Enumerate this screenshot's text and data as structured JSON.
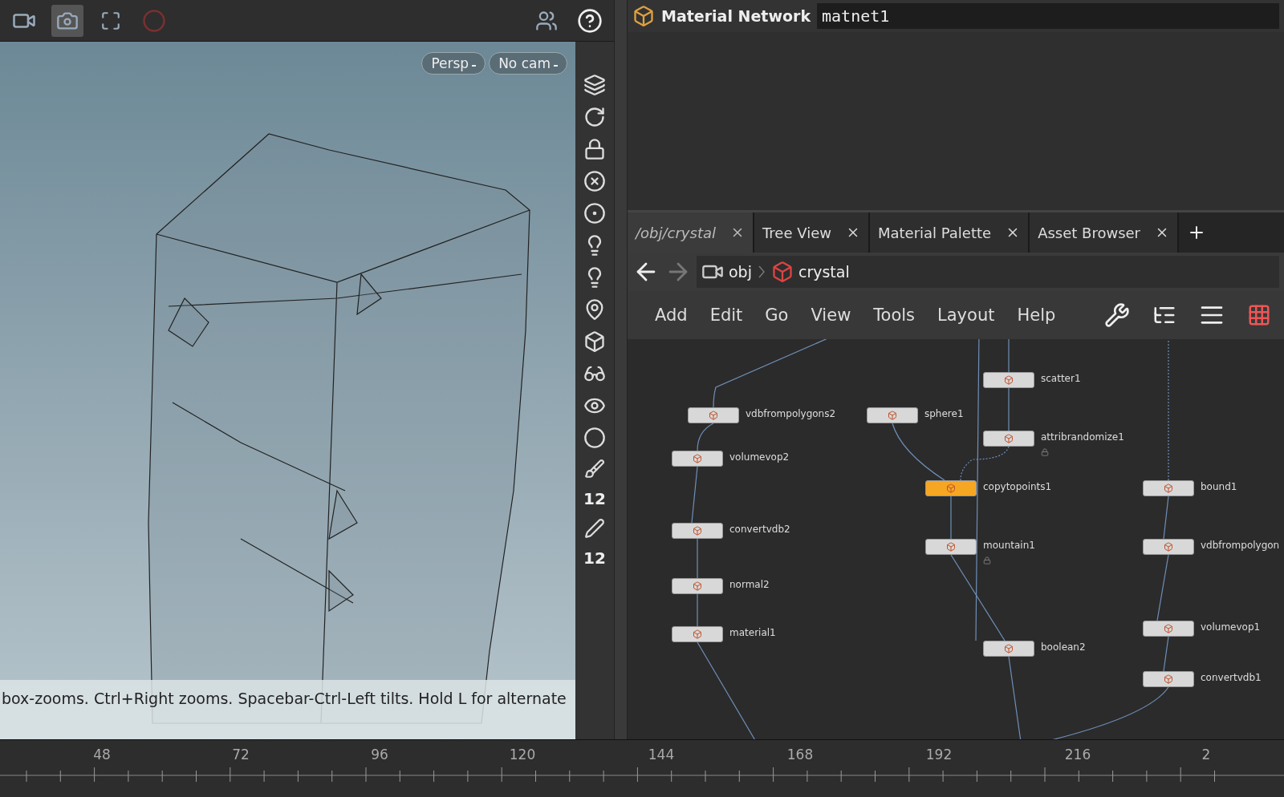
{
  "viewport": {
    "camera_menus": [
      "Persp",
      "No cam"
    ],
    "status": "box-zooms. Ctrl+Right zooms. Spacebar-Ctrl-Left tilts. Hold L for alternate"
  },
  "shelf_labels": [
    "12",
    "12"
  ],
  "material_network": {
    "title": "Material Network",
    "name_value": "matnet1"
  },
  "tabs": [
    {
      "label": "/obj/crystal",
      "selected": true
    },
    {
      "label": "Tree View",
      "selected": false
    },
    {
      "label": "Material Palette",
      "selected": false
    },
    {
      "label": "Asset Browser",
      "selected": false
    }
  ],
  "path": [
    "obj",
    "crystal"
  ],
  "menu": [
    "Add",
    "Edit",
    "Go",
    "View",
    "Tools",
    "Layout",
    "Help"
  ],
  "nodes": [
    {
      "name": "vdbfrompolygons2",
      "selected": false,
      "locked": false
    },
    {
      "name": "volumevop2",
      "selected": false,
      "locked": false
    },
    {
      "name": "convertvdb2",
      "selected": false,
      "locked": false
    },
    {
      "name": "normal2",
      "selected": false,
      "locked": false
    },
    {
      "name": "material1",
      "selected": false,
      "locked": false
    },
    {
      "name": "sphere1",
      "selected": false,
      "locked": false
    },
    {
      "name": "scatter1",
      "selected": false,
      "locked": false
    },
    {
      "name": "attribrandomize1",
      "selected": false,
      "locked": true
    },
    {
      "name": "copytopoints1",
      "selected": true,
      "locked": false
    },
    {
      "name": "mountain1",
      "selected": false,
      "locked": true
    },
    {
      "name": "boolean2",
      "selected": false,
      "locked": false
    },
    {
      "name": "bound1",
      "selected": false,
      "locked": false
    },
    {
      "name": "vdbfrompolygon",
      "selected": false,
      "locked": false
    },
    {
      "name": "volumevop1",
      "selected": false,
      "locked": false
    },
    {
      "name": "convertvdb1",
      "selected": false,
      "locked": false
    }
  ],
  "timeline": {
    "frames": [
      "48",
      "72",
      "96",
      "120",
      "144",
      "168",
      "192",
      "216",
      "2"
    ]
  }
}
